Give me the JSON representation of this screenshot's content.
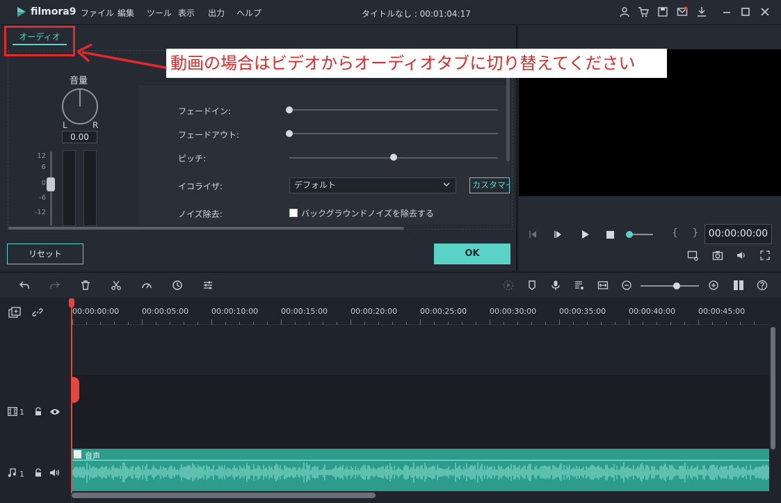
{
  "app": {
    "logo_text": "filmora9",
    "document_title": "タイトルなし : 00:01:04:17"
  },
  "menu": [
    "ファイル",
    "編集",
    "ツール",
    "表示",
    "出力",
    "ヘルプ"
  ],
  "audio_panel": {
    "tab_label": "オーディオ",
    "volume_label": "音量",
    "knob_left": "L",
    "knob_right": "R",
    "volume_value": "0.00",
    "db_scale": [
      "12",
      "6",
      "0",
      "-6",
      "-12"
    ],
    "fade_in_label": "フェードイン:",
    "fade_out_label": "フェードアウト:",
    "pitch_label": "ピッチ:",
    "equalizer_label": "イコライザ:",
    "equalizer_value": "デフォルト",
    "custom_button": "カスタマイズ",
    "denoise_label": "ノイズ除去:",
    "denoise_option": "バックグラウンドノイズを除去する",
    "fade_in_value": 0,
    "fade_out_value": 0,
    "pitch_value": 0.5,
    "reset_button": "リセット",
    "ok_button": "OK"
  },
  "annotation": {
    "text": "動画の場合はビデオからオーディオタブに切り替えてください",
    "color": "#e12a2a"
  },
  "player": {
    "timecode": "00:00:00:00",
    "brackets": "{ }"
  },
  "timeline": {
    "ruler": [
      "00:00:00:00",
      "00:00:05:00",
      "00:00:10:00",
      "00:00:15:00",
      "00:00:20:00",
      "00:00:25:00",
      "00:00:30:00",
      "00:00:35:00",
      "00:00:40:00",
      "00:00:45:00"
    ],
    "video_track_number": "1",
    "audio_track_number": "1",
    "audio_clip_title": "音声"
  },
  "colors": {
    "accent": "#5ad2c8",
    "playhead": "#e8453c",
    "audio_clip": "#2e9c8c"
  }
}
